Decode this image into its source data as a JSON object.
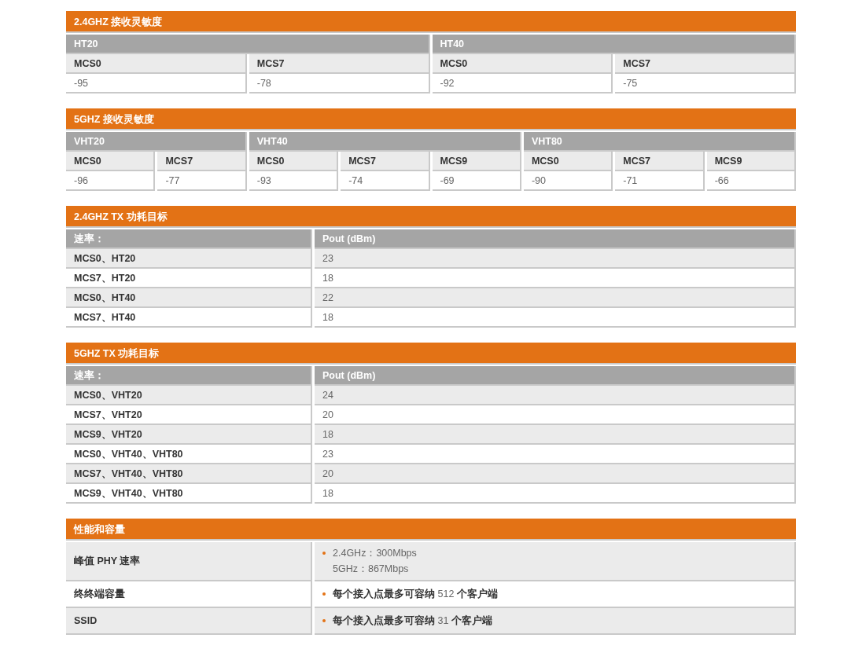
{
  "sections": [
    {
      "kind": "sensitivity",
      "title": "2.4GHZ 接收灵敏度",
      "groups": [
        {
          "label": "HT20",
          "columns": [
            {
              "header": "MCS0",
              "value": "-95"
            },
            {
              "header": "MCS7",
              "value": "-78"
            }
          ]
        },
        {
          "label": "HT40",
          "columns": [
            {
              "header": "MCS0",
              "value": "-92"
            },
            {
              "header": "MCS7",
              "value": "-75"
            }
          ]
        }
      ]
    },
    {
      "kind": "sensitivity",
      "title": "5GHZ 接收灵敏度",
      "groups": [
        {
          "label": "VHT20",
          "columns": [
            {
              "header": "MCS0",
              "value": "-96"
            },
            {
              "header": "MCS7",
              "value": "-77"
            }
          ]
        },
        {
          "label": "VHT40",
          "columns": [
            {
              "header": "MCS0",
              "value": "-93"
            },
            {
              "header": "MCS7",
              "value": "-74"
            },
            {
              "header": "MCS9",
              "value": "-69"
            }
          ]
        },
        {
          "label": "VHT80",
          "columns": [
            {
              "header": "MCS0",
              "value": "-90"
            },
            {
              "header": "MCS7",
              "value": "-71"
            },
            {
              "header": "MCS9",
              "value": "-66"
            }
          ]
        }
      ]
    },
    {
      "kind": "power",
      "title": "2.4GHZ TX 功耗目标",
      "columns": [
        "速率：",
        "Pout (dBm)"
      ],
      "rows": [
        {
          "rate": "MCS0、HT20",
          "pout": "23"
        },
        {
          "rate": "MCS7、HT20",
          "pout": "18"
        },
        {
          "rate": "MCS0、HT40",
          "pout": "22"
        },
        {
          "rate": "MCS7、HT40",
          "pout": "18"
        }
      ]
    },
    {
      "kind": "power",
      "title": "5GHZ TX 功耗目标",
      "columns": [
        "速率：",
        "Pout (dBm)"
      ],
      "rows": [
        {
          "rate": "MCS0、VHT20",
          "pout": "24"
        },
        {
          "rate": "MCS7、VHT20",
          "pout": "20"
        },
        {
          "rate": "MCS9、VHT20",
          "pout": "18"
        },
        {
          "rate": "MCS0、VHT40、VHT80",
          "pout": "23"
        },
        {
          "rate": "MCS7、VHT40、VHT80",
          "pout": "20"
        },
        {
          "rate": "MCS9、VHT40、VHT80",
          "pout": "18"
        }
      ]
    },
    {
      "kind": "performance",
      "title": "性能和容量",
      "rows": [
        {
          "label": "峰值 PHY 速率",
          "lines": [
            "2.4GHz：300Mbps",
            "5GHz：867Mbps"
          ]
        },
        {
          "label": "终终端容量",
          "lines": [
            "**每个接入点最多可容纳** 512 **个客户端**"
          ]
        },
        {
          "label": "SSID",
          "lines": [
            "**每个接入点最多可容纳** 31 **个客户端**"
          ]
        }
      ]
    }
  ]
}
